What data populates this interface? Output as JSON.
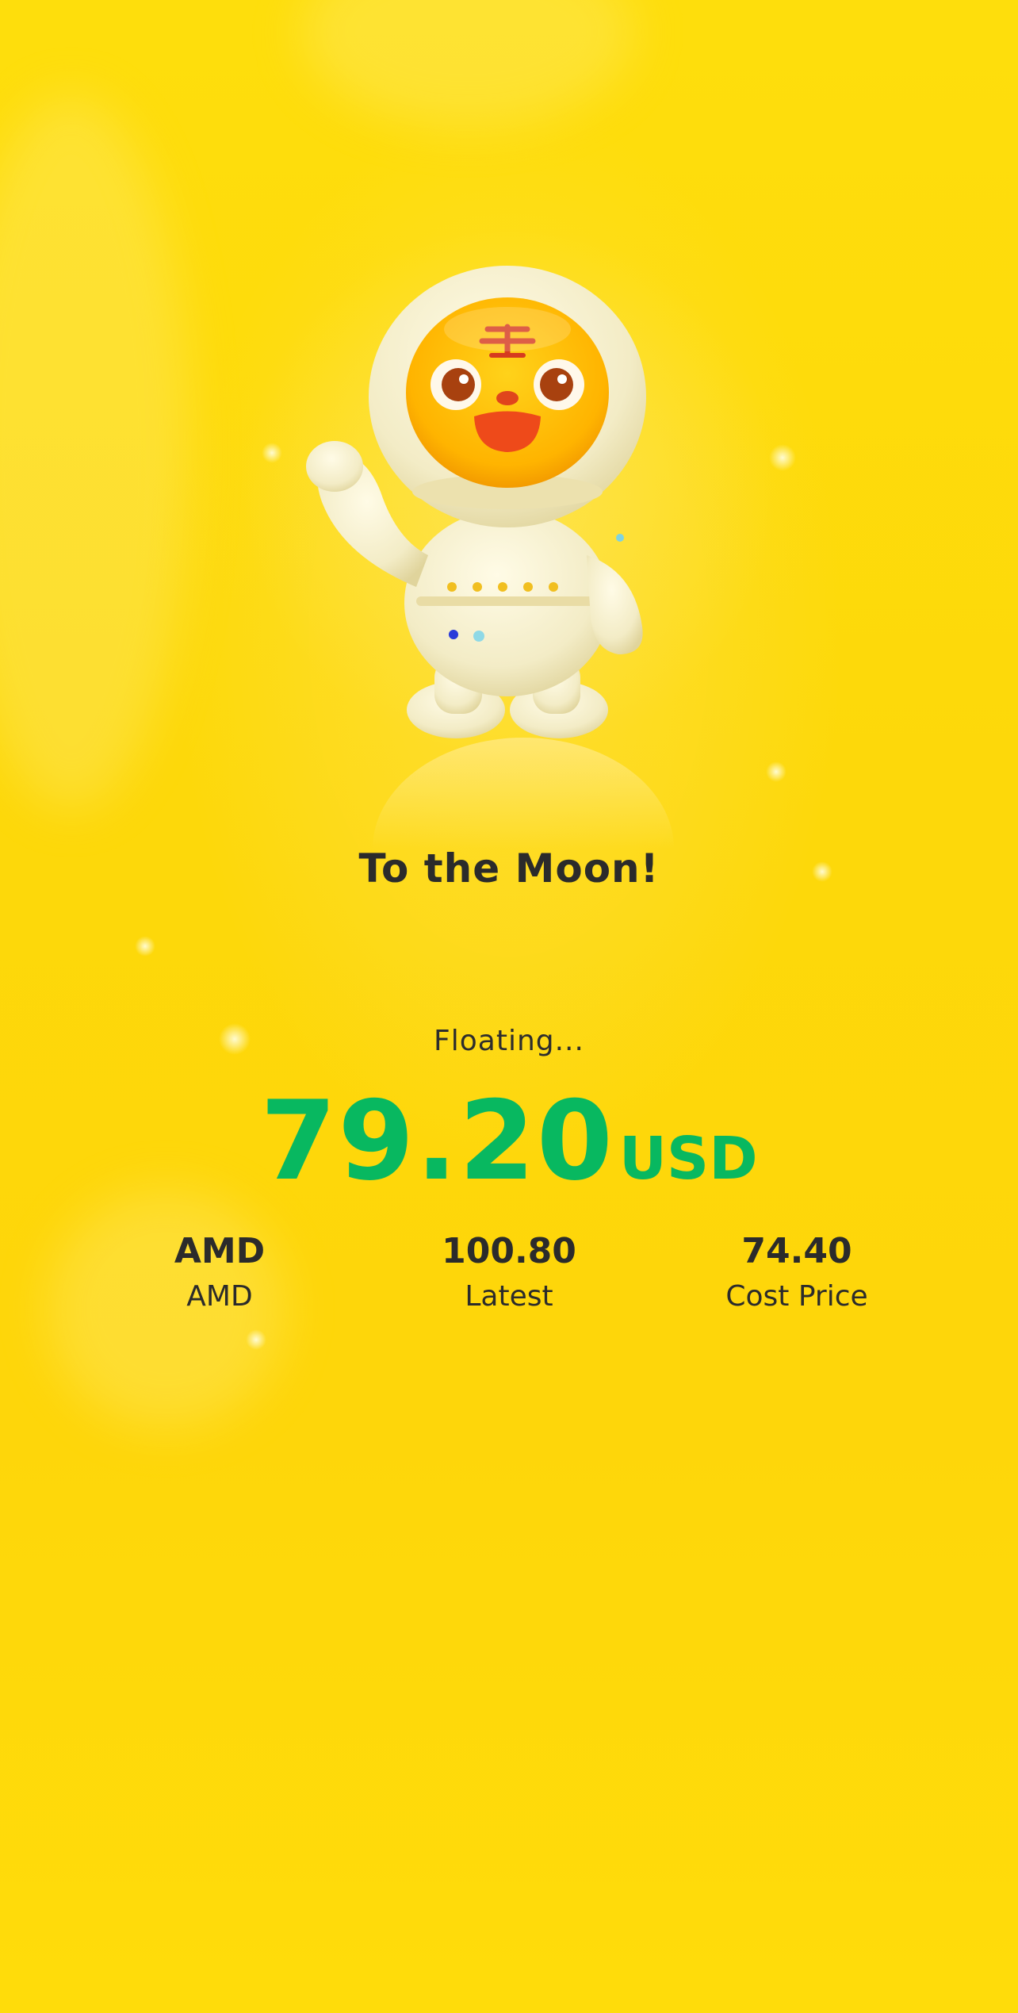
{
  "header": {
    "title": "To the Moon!"
  },
  "result": {
    "status_label": "Floating...",
    "amount": "79.20",
    "currency": "USD",
    "amount_color": "#08b860"
  },
  "stats": [
    {
      "value": "AMD",
      "label": "AMD"
    },
    {
      "value": "100.80",
      "label": "Latest"
    },
    {
      "value": "74.40",
      "label": "Cost Price"
    }
  ],
  "colors": {
    "background": "#fdd80a",
    "text": "#2b2b2b",
    "gain": "#08b860"
  },
  "illustration": {
    "icon": "astronaut-tiger-mascot-icon"
  }
}
